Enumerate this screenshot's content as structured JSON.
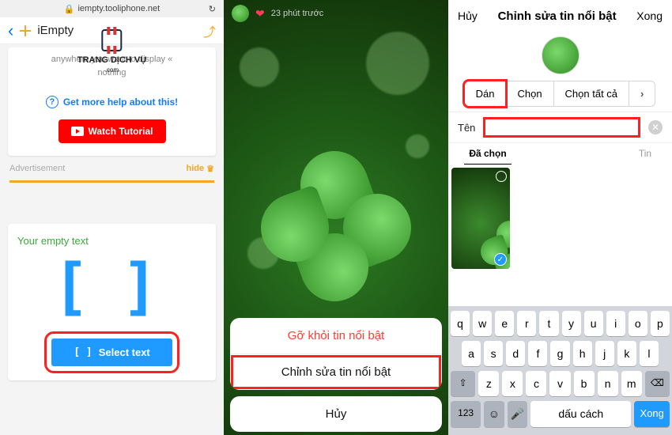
{
  "col1": {
    "url": "iempty.tooliphone.net",
    "site_name": "iEmpty",
    "card_subtext": "anywhere you want to display «",
    "nothing": "nothing",
    "watermark": "TRANG DỊCH VỤ",
    "watermark_sub": ".com",
    "help_link": "Get more help about this!",
    "watch_btn": "Watch Tutorial",
    "ad_label": "Advertisement",
    "hide": "hide",
    "your_empty": "Your empty text",
    "brackets": "[]",
    "select_btn": "Select text"
  },
  "col2": {
    "time_ago": "23 phút trước",
    "remove": "Gỡ khỏi tin nổi bật",
    "edit": "Chỉnh sửa tin nổi bật",
    "cancel": "Hủy"
  },
  "col3": {
    "nav": {
      "cancel": "Hủy",
      "title": "Chỉnh sửa tin nổi bật",
      "done": "Xong"
    },
    "ctx": {
      "paste": "Dán",
      "select": "Chọn",
      "select_all": "Chọn tất cả",
      "arrow": "›"
    },
    "name_label": "Tên",
    "tabs": {
      "selected": "Đã chọn",
      "story": "Tin"
    },
    "keyboard": {
      "r1": [
        "q",
        "w",
        "e",
        "r",
        "t",
        "y",
        "u",
        "i",
        "o",
        "p"
      ],
      "r2": [
        "a",
        "s",
        "d",
        "f",
        "g",
        "h",
        "j",
        "k",
        "l"
      ],
      "r3_shift": "⇧",
      "r3": [
        "z",
        "x",
        "c",
        "v",
        "b",
        "n",
        "m"
      ],
      "r3_del": "⌫",
      "r4": {
        "num": "123",
        "emoji": "☺",
        "mic": "🎤",
        "space": "dấu cách",
        "done": "Xong"
      }
    }
  }
}
